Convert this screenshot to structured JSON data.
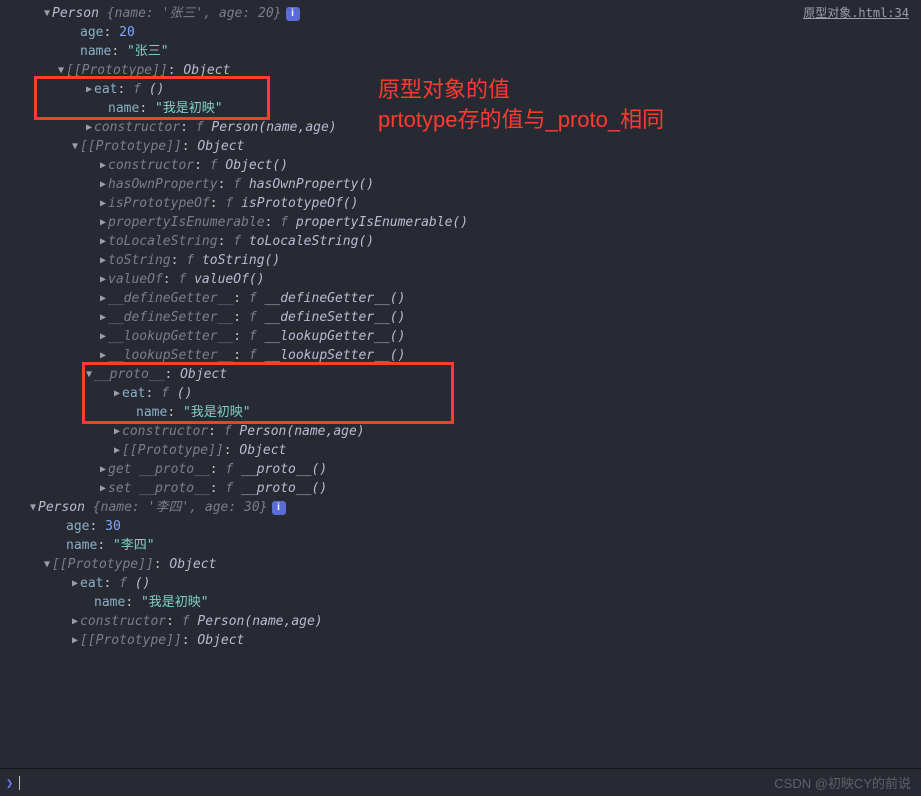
{
  "source_link": "原型对象.html:34",
  "annotation": {
    "line1": "原型对象的值",
    "line2": "prtotype存的值与_proto_相同"
  },
  "watermark": "CSDN @初映CY的前说",
  "rows": [
    {
      "i": 3,
      "a": "▼",
      "cls": true,
      "t1": "Person ",
      "prev": "{name: '张三', age: 20}",
      "info": true
    },
    {
      "i": 5,
      "a": "",
      "own": "age",
      "colon": ": ",
      "num": "20"
    },
    {
      "i": 5,
      "a": "",
      "own": "name",
      "colon": ": ",
      "str": "\"张三\""
    },
    {
      "i": 4,
      "a": "▼",
      "prop": "[[Prototype]]",
      "colon": ": ",
      "val": "Object"
    },
    {
      "i": 6,
      "a": "▶",
      "own": "eat",
      "colon": ": ",
      "fkw": "f ",
      "fn": "()"
    },
    {
      "i": 7,
      "a": "",
      "own": "name",
      "colon": ": ",
      "str": "\"我是初映\""
    },
    {
      "i": 6,
      "a": "▶",
      "prop": "constructor",
      "colon": ": ",
      "fkw": "f ",
      "fn": "Person(name,age)"
    },
    {
      "i": 5,
      "a": "▼",
      "prop": "[[Prototype]]",
      "colon": ": ",
      "val": "Object"
    },
    {
      "i": 7,
      "a": "▶",
      "prop": "constructor",
      "colon": ": ",
      "fkw": "f ",
      "fn": "Object()"
    },
    {
      "i": 7,
      "a": "▶",
      "prop": "hasOwnProperty",
      "colon": ": ",
      "fkw": "f ",
      "fn": "hasOwnProperty()"
    },
    {
      "i": 7,
      "a": "▶",
      "prop": "isPrototypeOf",
      "colon": ": ",
      "fkw": "f ",
      "fn": "isPrototypeOf()"
    },
    {
      "i": 7,
      "a": "▶",
      "prop": "propertyIsEnumerable",
      "colon": ": ",
      "fkw": "f ",
      "fn": "propertyIsEnumerable()"
    },
    {
      "i": 7,
      "a": "▶",
      "prop": "toLocaleString",
      "colon": ": ",
      "fkw": "f ",
      "fn": "toLocaleString()"
    },
    {
      "i": 7,
      "a": "▶",
      "prop": "toString",
      "colon": ": ",
      "fkw": "f ",
      "fn": "toString()"
    },
    {
      "i": 7,
      "a": "▶",
      "prop": "valueOf",
      "colon": ": ",
      "fkw": "f ",
      "fn": "valueOf()"
    },
    {
      "i": 7,
      "a": "▶",
      "prop": "__defineGetter__",
      "colon": ": ",
      "fkw": "f ",
      "fn": "__defineGetter__()"
    },
    {
      "i": 7,
      "a": "▶",
      "prop": "__defineSetter__",
      "colon": ": ",
      "fkw": "f ",
      "fn": "__defineSetter__()"
    },
    {
      "i": 7,
      "a": "▶",
      "prop": "__lookupGetter__",
      "colon": ": ",
      "fkw": "f ",
      "fn": "__lookupGetter__()"
    },
    {
      "i": 7,
      "a": "▶",
      "prop": "__lookupSetter__",
      "colon": ": ",
      "fkw": "f ",
      "fn": "__lookupSetter__()"
    },
    {
      "i": 6,
      "a": "▼",
      "prop": "__proto__",
      "colon": ": ",
      "val": "Object"
    },
    {
      "i": 8,
      "a": "▶",
      "own": "eat",
      "colon": ": ",
      "fkw": "f ",
      "fn": "()"
    },
    {
      "i": 9,
      "a": "",
      "own": "name",
      "colon": ": ",
      "str": "\"我是初映\""
    },
    {
      "i": 8,
      "a": "▶",
      "prop": "constructor",
      "colon": ": ",
      "fkw": "f ",
      "fn": "Person(name,age)"
    },
    {
      "i": 8,
      "a": "▶",
      "prop": "[[Prototype]]",
      "colon": ": ",
      "val": "Object"
    },
    {
      "i": 7,
      "a": "▶",
      "prop": "get __proto__",
      "colon": ": ",
      "fkw": "f ",
      "fn": "__proto__()"
    },
    {
      "i": 7,
      "a": "▶",
      "prop": "set __proto__",
      "colon": ": ",
      "fkw": "f ",
      "fn": "__proto__()"
    },
    {
      "i": 2,
      "a": "▼",
      "cls": true,
      "t1": "Person ",
      "prev": "{name: '李四', age: 30}",
      "info": true
    },
    {
      "i": 4,
      "a": "",
      "own": "age",
      "colon": ": ",
      "num": "30"
    },
    {
      "i": 4,
      "a": "",
      "own": "name",
      "colon": ": ",
      "str": "\"李四\""
    },
    {
      "i": 3,
      "a": "▼",
      "prop": "[[Prototype]]",
      "colon": ": ",
      "val": "Object"
    },
    {
      "i": 5,
      "a": "▶",
      "own": "eat",
      "colon": ": ",
      "fkw": "f ",
      "fn": "()"
    },
    {
      "i": 6,
      "a": "",
      "own": "name",
      "colon": ": ",
      "str": "\"我是初映\""
    },
    {
      "i": 5,
      "a": "▶",
      "prop": "constructor",
      "colon": ": ",
      "fkw": "f ",
      "fn": "Person(name,age)"
    },
    {
      "i": 5,
      "a": "▶",
      "prop": "[[Prototype]]",
      "colon": ": ",
      "val": "Object"
    }
  ]
}
